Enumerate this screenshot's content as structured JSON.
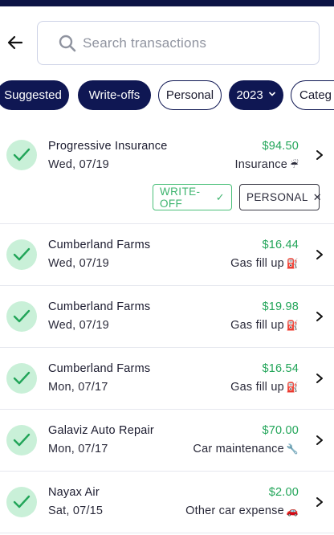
{
  "search": {
    "placeholder": "Search transactions"
  },
  "filters": [
    {
      "label": "Suggested",
      "style": "dark"
    },
    {
      "label": "Write-offs",
      "style": "dark"
    },
    {
      "label": "Personal",
      "style": "light"
    },
    {
      "label": "2023",
      "style": "dark",
      "dropdown": true
    },
    {
      "label": "Categ",
      "style": "light"
    }
  ],
  "transactions": [
    {
      "merchant": "Progressive Insurance",
      "date": "Wed, 07/19",
      "amount": "$94.50",
      "category": "Insurance",
      "category_icon": "umbrella-icon",
      "emoji": "☔",
      "tags": [
        {
          "label": "WRITE-OFF",
          "icon": "check-icon",
          "glyph": "✓"
        },
        {
          "label": "PERSONAL",
          "icon": "close-icon",
          "glyph": "✕"
        }
      ]
    },
    {
      "merchant": "Cumberland Farms",
      "date": "Wed, 07/19",
      "amount": "$16.44",
      "category": "Gas fill up",
      "category_icon": "fuel-pump-icon",
      "emoji": "⛽"
    },
    {
      "merchant": "Cumberland Farms",
      "date": "Wed, 07/19",
      "amount": "$19.98",
      "category": "Gas fill up",
      "category_icon": "fuel-pump-icon",
      "emoji": "⛽"
    },
    {
      "merchant": "Cumberland Farms",
      "date": "Mon, 07/17",
      "amount": "$16.54",
      "category": "Gas fill up",
      "category_icon": "fuel-pump-icon",
      "emoji": "⛽"
    },
    {
      "merchant": "Galaviz Auto Repair",
      "date": "Mon, 07/17",
      "amount": "$70.00",
      "category": "Car maintenance",
      "category_icon": "wrench-icon",
      "emoji": "🔧"
    },
    {
      "merchant": "Nayax Air",
      "date": "Sat, 07/15",
      "amount": "$2.00",
      "category": "Other car expense",
      "category_icon": "car-icon",
      "emoji": "🚗"
    }
  ],
  "colors": {
    "navy": "#0f1753",
    "green": "#22a559",
    "check_bg": "#c9f0d8"
  }
}
